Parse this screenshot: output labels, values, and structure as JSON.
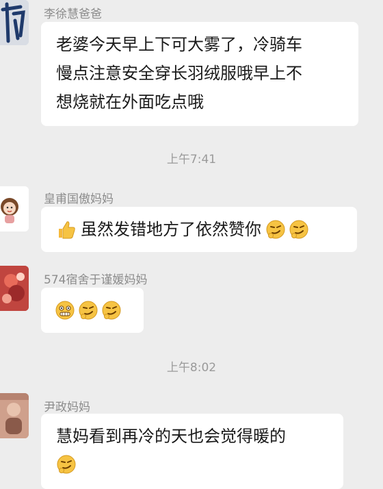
{
  "messages": [
    {
      "sender": "李徐慧爸爸",
      "lines": [
        "老婆今天早上下可大雾了，冷骑车",
        "慢点注意安全穿长羽绒服哦早上不",
        "想烧就在外面吃点哦"
      ]
    },
    {
      "sender": "皇甫国傲妈妈",
      "text": "虽然发错地方了依然赞你",
      "emoji_prefix": "thumbs-up-icon",
      "emoji_suffix": [
        "smirk-icon",
        "smirk-icon"
      ]
    },
    {
      "sender": "574宿舍于谨媛妈妈",
      "emojis": [
        "grimace-icon",
        "smirk-icon",
        "smirk-icon"
      ]
    },
    {
      "sender": "尹政妈妈",
      "lines": [
        "慧妈看到再冷的天也会觉得暖的"
      ],
      "emoji_suffix": [
        "smirk-icon"
      ]
    }
  ],
  "timestamps": [
    "上午7:41",
    "上午8:02"
  ],
  "colors": {
    "background": "#ededed",
    "bubble": "#ffffff",
    "meta_text": "#8c8c8c",
    "emoji_yellow": "#f6c343"
  }
}
